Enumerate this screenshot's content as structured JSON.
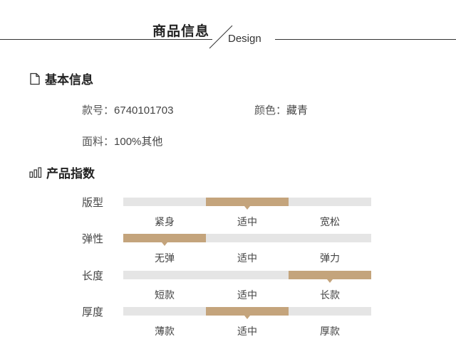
{
  "header": {
    "title": "商品信息",
    "subtitle": "Design"
  },
  "basic": {
    "title": "基本信息",
    "icon": "document-icon",
    "code_label": "款号：",
    "code_value": "6740101703",
    "color_label": "颜色：",
    "color_value": "藏青",
    "fabric_label": "面料：",
    "fabric_value": "100%其他"
  },
  "index": {
    "title": "产品指数",
    "icon": "bar-chart-icon",
    "accent_color": "#c4a47c",
    "track_color": "#e5e5e5",
    "rows": [
      {
        "label": "版型",
        "options": [
          "紧身",
          "适中",
          "宽松"
        ],
        "selected": 1
      },
      {
        "label": "弹性",
        "options": [
          "无弹",
          "适中",
          "弹力"
        ],
        "selected": 0
      },
      {
        "label": "长度",
        "options": [
          "短款",
          "适中",
          "长款"
        ],
        "selected": 2
      },
      {
        "label": "厚度",
        "options": [
          "薄款",
          "适中",
          "厚款"
        ],
        "selected": 1
      }
    ]
  }
}
